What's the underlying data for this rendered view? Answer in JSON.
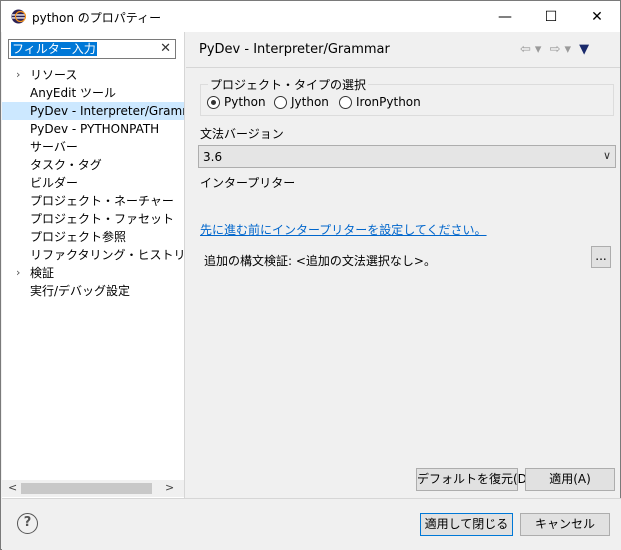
{
  "window": {
    "title": "python のプロパティー",
    "minimize": "—",
    "maximize": "☐",
    "close": "✕"
  },
  "filter": {
    "value": "フィルター入力",
    "clear": "✕"
  },
  "tree": {
    "items": [
      {
        "label": "リソース",
        "expandable": true
      },
      {
        "label": "AnyEdit ツール",
        "expandable": false
      },
      {
        "label": "PyDev - Interpreter/Gramma",
        "expandable": false,
        "selected": true
      },
      {
        "label": "PyDev - PYTHONPATH",
        "expandable": false
      },
      {
        "label": "サーバー",
        "expandable": false
      },
      {
        "label": "タスク・タグ",
        "expandable": false
      },
      {
        "label": "ビルダー",
        "expandable": false
      },
      {
        "label": "プロジェクト・ネーチャー",
        "expandable": false
      },
      {
        "label": "プロジェクト・ファセット",
        "expandable": false
      },
      {
        "label": "プロジェクト参照",
        "expandable": false
      },
      {
        "label": "リファクタリング・ヒストリー",
        "expandable": false
      },
      {
        "label": "検証",
        "expandable": true
      },
      {
        "label": "実行/デバッグ設定",
        "expandable": false
      }
    ],
    "scroll_left": "<",
    "scroll_right": ">"
  },
  "page": {
    "title": "PyDev - Interpreter/Grammar",
    "nav_back": "⇦",
    "nav_back_dd": "▾",
    "nav_forward": "⇨",
    "nav_forward_dd": "▾",
    "menu": "▼"
  },
  "project_type": {
    "legend": "プロジェクト・タイプの選択",
    "options": [
      {
        "label": "Python",
        "checked": true
      },
      {
        "label": "Jython",
        "checked": false
      },
      {
        "label": "IronPython",
        "checked": false
      }
    ]
  },
  "grammar": {
    "label": "文法バージョン",
    "value": "3.6",
    "arrow": "∨"
  },
  "interpreter": {
    "label": "インタープリター",
    "link": "先に進む前にインタープリターを設定してください。"
  },
  "extra_syntax": {
    "label": "追加の構文検証: <追加の文法選択なし>。",
    "button": "..."
  },
  "buttons": {
    "restore_defaults": "デフォルトを復元(D)",
    "apply": "適用(A)",
    "apply_close": "適用して閉じる",
    "cancel": "キャンセル",
    "help": "?"
  },
  "colors": {
    "accent": "#0078d7",
    "selection": "#cce8ff",
    "link": "#0066cc"
  }
}
